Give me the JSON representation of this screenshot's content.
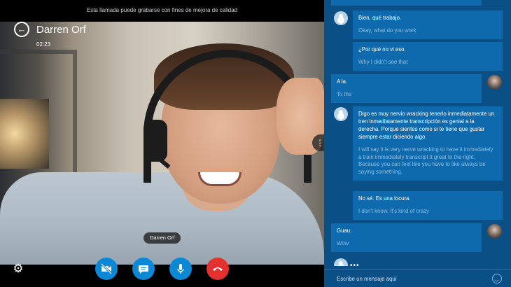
{
  "call": {
    "recording_notice": "Esta llamada puede grabarse con fines de mejora de calidad",
    "caller_name": "Darren Orf",
    "timer": "02:23",
    "name_tag": "Darren Orf"
  },
  "chat": {
    "messages": [
      {
        "side": "left",
        "original": "Bien, qué trabajo.",
        "translation": "Okay, what do you work"
      },
      {
        "side": "left",
        "original": "¿Por qué no vi eso.",
        "translation": "Why I didn't see that"
      },
      {
        "side": "right",
        "original": "A la.",
        "translation": "To the"
      },
      {
        "side": "left",
        "original": "Digo es muy nervio wracking tenerlo inmediatamente un tren inmediatamente transcripción es genial a la derecha. Porque sientes como si te tiene que gustar siempre estar diciendo algo.",
        "translation": "I will say it is very nerve wracking to have it immediately a train immediately transcript it great to the right. Because you can feel like you have to like always be saying something."
      },
      {
        "side": "left",
        "original": "No sé. Es una locura.",
        "translation": "I don't know. It's kind of crazy"
      },
      {
        "side": "right",
        "original": "Guau.",
        "translation": "Wow"
      }
    ],
    "typing_indicator": "•••",
    "composer_placeholder": "Escribe un mensaje aquí"
  },
  "colors": {
    "panel_bg": "#0a4f86",
    "bubble_bg": "#0e6aad",
    "translation_text": "#8fbde0",
    "control_blue": "#0a88d6",
    "end_call_red": "#e2312f"
  },
  "icons": [
    "back-arrow-icon",
    "more-icon",
    "gear-icon",
    "video-off-icon",
    "chat-icon",
    "mic-icon",
    "hang-up-icon",
    "emoji-icon"
  ]
}
